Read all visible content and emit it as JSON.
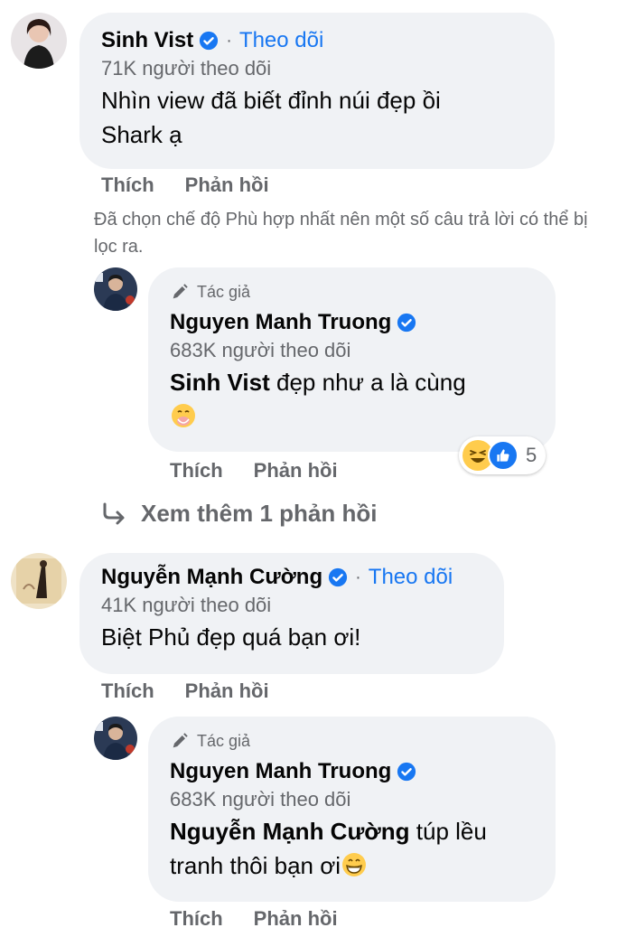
{
  "comments": [
    {
      "name": "Sinh Vist",
      "follow": "Theo dõi",
      "followers": "71K người theo dõi",
      "text_line1": "Nhìn view đã biết đỉnh núi đẹp ồi",
      "text_line2": "Shark ạ",
      "like": "Thích",
      "reply": "Phản hồi"
    },
    {
      "name": "Nguyễn Mạnh Cường",
      "follow": "Theo dõi",
      "followers": "41K người theo dõi",
      "text": "Biệt Phủ đẹp quá bạn ơi!",
      "like": "Thích",
      "reply": "Phản hồi"
    }
  ],
  "filter_note": "Đã chọn chế độ Phù hợp nhất nên một số câu trả lời có thể bị lọc ra.",
  "replies": [
    {
      "author_tag": "Tác giả",
      "name": "Nguyen Manh Truong",
      "followers": "683K người theo dõi",
      "mention": "Sinh Vist",
      "text": "đẹp như a là cùng",
      "reaction_count": "5",
      "like": "Thích",
      "reply": "Phản hồi"
    },
    {
      "author_tag": "Tác giả",
      "name": "Nguyen Manh Truong",
      "followers": "683K người theo dõi",
      "mention": "Nguyễn Mạnh Cường",
      "text_part1": "túp lều",
      "text_line2": "tranh thôi bạn ơi",
      "like": "Thích",
      "reply": "Phản hồi"
    }
  ],
  "more_replies": "Xem thêm 1 phản hồi",
  "colors": {
    "link": "#1877f2",
    "secondary": "#65676b",
    "bubble": "#f0f2f5"
  }
}
